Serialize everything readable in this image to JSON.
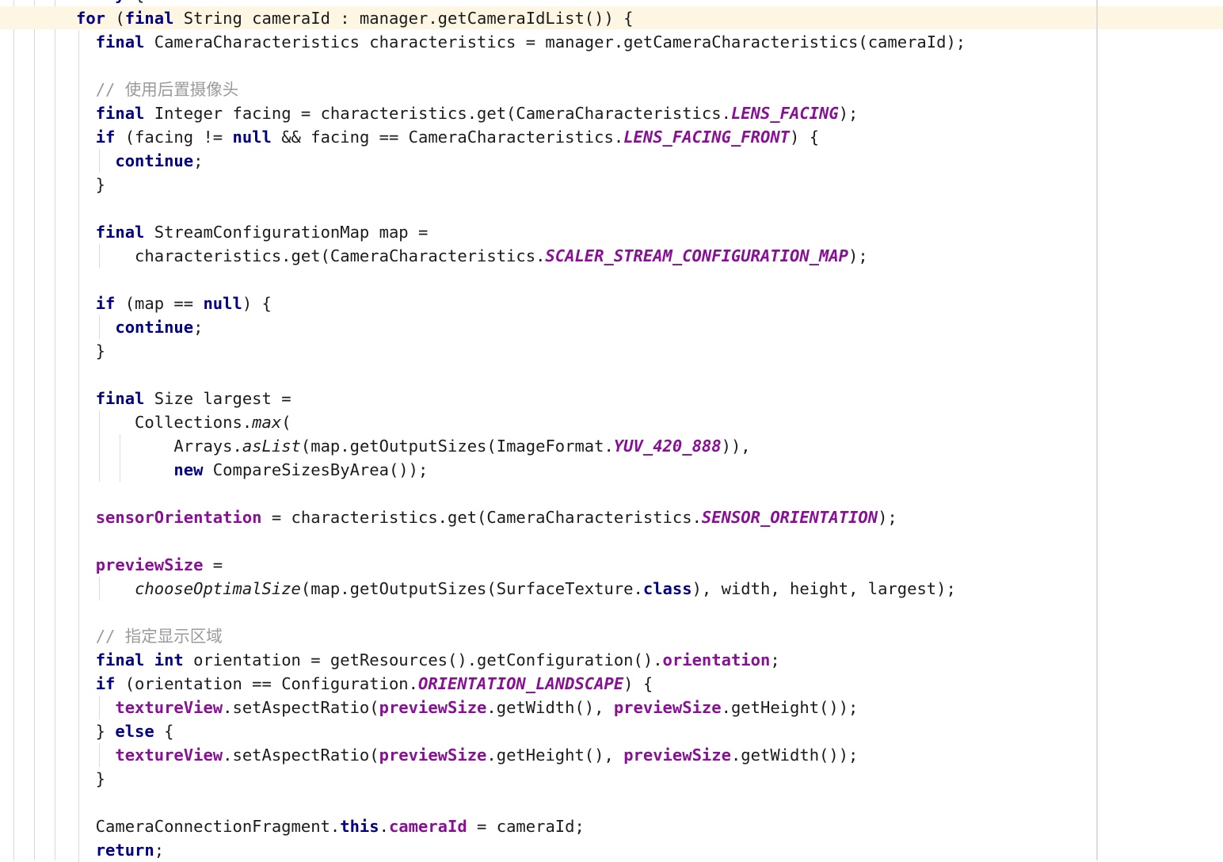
{
  "editor": {
    "kind": "java-source-code-editor",
    "language": "Java",
    "theme": "light",
    "font_size_px": 20,
    "line_height_px": 30,
    "right_margin_column_x": 1384,
    "colors": {
      "background": "#ffffff",
      "foreground": "#1b1b1b",
      "keyword": "#000080",
      "static_constant": "#871094",
      "field": "#871094",
      "comment": "#9a9a9a",
      "caret_line_highlight": "#fdf6e3",
      "indent_guide": "#d7d7d7",
      "right_margin_ruler": "#dcdcdc"
    }
  },
  "code_lines": [
    {
      "id": "l01",
      "clipped": true,
      "highlight": false,
      "guides": [],
      "tokens": [
        {
          "t": "plain",
          "v": "  "
        },
        {
          "t": "keyword",
          "v": "try"
        },
        {
          "t": "plain",
          "v": " {"
        }
      ]
    },
    {
      "id": "l02",
      "highlight": true,
      "guides": [],
      "tokens": [
        {
          "t": "keyword",
          "v": "for"
        },
        {
          "t": "plain",
          "v": " ("
        },
        {
          "t": "keyword",
          "v": "final"
        },
        {
          "t": "plain",
          "v": " String cameraId : manager.getCameraIdList()) {"
        }
      ]
    },
    {
      "id": "l03",
      "highlight": false,
      "guides": [
        "i95"
      ],
      "tokens": [
        {
          "t": "plain",
          "v": "  "
        },
        {
          "t": "keyword",
          "v": "final"
        },
        {
          "t": "plain",
          "v": " CameraCharacteristics characteristics = manager.getCameraCharacteristics(cameraId);"
        }
      ]
    },
    {
      "id": "l04",
      "highlight": false,
      "guides": [
        "i95"
      ],
      "tokens": []
    },
    {
      "id": "l05",
      "highlight": false,
      "guides": [
        "i95"
      ],
      "tokens": [
        {
          "t": "plain",
          "v": "  "
        },
        {
          "t": "comment",
          "v": "// 使用后置摄像头"
        }
      ]
    },
    {
      "id": "l06",
      "highlight": false,
      "guides": [
        "i95"
      ],
      "tokens": [
        {
          "t": "plain",
          "v": "  "
        },
        {
          "t": "keyword",
          "v": "final"
        },
        {
          "t": "plain",
          "v": " Integer facing = characteristics.get(CameraCharacteristics."
        },
        {
          "t": "static_constant",
          "v": "LENS_FACING"
        },
        {
          "t": "plain",
          "v": ");"
        }
      ]
    },
    {
      "id": "l07",
      "highlight": false,
      "guides": [
        "i95"
      ],
      "tokens": [
        {
          "t": "plain",
          "v": "  "
        },
        {
          "t": "keyword",
          "v": "if"
        },
        {
          "t": "plain",
          "v": " (facing != "
        },
        {
          "t": "keyword",
          "v": "null"
        },
        {
          "t": "plain",
          "v": " && facing == CameraCharacteristics."
        },
        {
          "t": "static_constant",
          "v": "LENS_FACING_FRONT"
        },
        {
          "t": "plain",
          "v": ") {"
        }
      ]
    },
    {
      "id": "l08",
      "highlight": false,
      "guides": [
        "i95",
        "i121"
      ],
      "tokens": [
        {
          "t": "plain",
          "v": "    "
        },
        {
          "t": "keyword",
          "v": "continue"
        },
        {
          "t": "plain",
          "v": ";"
        }
      ]
    },
    {
      "id": "l09",
      "highlight": false,
      "guides": [
        "i95"
      ],
      "tokens": [
        {
          "t": "plain",
          "v": "  }"
        }
      ]
    },
    {
      "id": "l10",
      "highlight": false,
      "guides": [
        "i95"
      ],
      "tokens": []
    },
    {
      "id": "l11",
      "highlight": false,
      "guides": [
        "i95"
      ],
      "tokens": [
        {
          "t": "plain",
          "v": "  "
        },
        {
          "t": "keyword",
          "v": "final"
        },
        {
          "t": "plain",
          "v": " StreamConfigurationMap map ="
        }
      ]
    },
    {
      "id": "l12",
      "highlight": false,
      "guides": [
        "i95",
        "i121"
      ],
      "tokens": [
        {
          "t": "plain",
          "v": "      characteristics.get(CameraCharacteristics."
        },
        {
          "t": "static_constant",
          "v": "SCALER_STREAM_CONFIGURATION_MAP"
        },
        {
          "t": "plain",
          "v": ");"
        }
      ]
    },
    {
      "id": "l13",
      "highlight": false,
      "guides": [
        "i95"
      ],
      "tokens": []
    },
    {
      "id": "l14",
      "highlight": false,
      "guides": [
        "i95"
      ],
      "tokens": [
        {
          "t": "plain",
          "v": "  "
        },
        {
          "t": "keyword",
          "v": "if"
        },
        {
          "t": "plain",
          "v": " (map == "
        },
        {
          "t": "keyword",
          "v": "null"
        },
        {
          "t": "plain",
          "v": ") {"
        }
      ]
    },
    {
      "id": "l15",
      "highlight": false,
      "guides": [
        "i95",
        "i121"
      ],
      "tokens": [
        {
          "t": "plain",
          "v": "    "
        },
        {
          "t": "keyword",
          "v": "continue"
        },
        {
          "t": "plain",
          "v": ";"
        }
      ]
    },
    {
      "id": "l16",
      "highlight": false,
      "guides": [
        "i95"
      ],
      "tokens": [
        {
          "t": "plain",
          "v": "  }"
        }
      ]
    },
    {
      "id": "l17",
      "highlight": false,
      "guides": [
        "i95"
      ],
      "tokens": []
    },
    {
      "id": "l18",
      "highlight": false,
      "guides": [
        "i95"
      ],
      "tokens": [
        {
          "t": "plain",
          "v": "  "
        },
        {
          "t": "keyword",
          "v": "final"
        },
        {
          "t": "plain",
          "v": " Size largest ="
        }
      ]
    },
    {
      "id": "l19",
      "highlight": false,
      "guides": [
        "i95",
        "i121"
      ],
      "tokens": [
        {
          "t": "plain",
          "v": "      Collections."
        },
        {
          "t": "static_method",
          "v": "max"
        },
        {
          "t": "plain",
          "v": "("
        }
      ]
    },
    {
      "id": "l20",
      "highlight": false,
      "guides": [
        "i95",
        "i121",
        "i147"
      ],
      "tokens": [
        {
          "t": "plain",
          "v": "          Arrays."
        },
        {
          "t": "static_method",
          "v": "asList"
        },
        {
          "t": "plain",
          "v": "(map.getOutputSizes(ImageFormat."
        },
        {
          "t": "static_constant",
          "v": "YUV_420_888"
        },
        {
          "t": "plain",
          "v": ")),"
        }
      ]
    },
    {
      "id": "l21",
      "highlight": false,
      "guides": [
        "i95",
        "i121",
        "i147"
      ],
      "tokens": [
        {
          "t": "plain",
          "v": "          "
        },
        {
          "t": "keyword",
          "v": "new"
        },
        {
          "t": "plain",
          "v": " CompareSizesByArea());"
        }
      ]
    },
    {
      "id": "l22",
      "highlight": false,
      "guides": [
        "i95"
      ],
      "tokens": []
    },
    {
      "id": "l23",
      "highlight": false,
      "guides": [
        "i95"
      ],
      "tokens": [
        {
          "t": "plain",
          "v": "  "
        },
        {
          "t": "field",
          "v": "sensorOrientation"
        },
        {
          "t": "plain",
          "v": " = characteristics.get(CameraCharacteristics."
        },
        {
          "t": "static_constant",
          "v": "SENSOR_ORIENTATION"
        },
        {
          "t": "plain",
          "v": ");"
        }
      ]
    },
    {
      "id": "l24",
      "highlight": false,
      "guides": [
        "i95"
      ],
      "tokens": []
    },
    {
      "id": "l25",
      "highlight": false,
      "guides": [
        "i95"
      ],
      "tokens": [
        {
          "t": "plain",
          "v": "  "
        },
        {
          "t": "field",
          "v": "previewSize"
        },
        {
          "t": "plain",
          "v": " ="
        }
      ]
    },
    {
      "id": "l26",
      "highlight": false,
      "guides": [
        "i95",
        "i121"
      ],
      "tokens": [
        {
          "t": "plain",
          "v": "      "
        },
        {
          "t": "static_method",
          "v": "chooseOptimalSize"
        },
        {
          "t": "plain",
          "v": "(map.getOutputSizes(SurfaceTexture."
        },
        {
          "t": "keyword",
          "v": "class"
        },
        {
          "t": "plain",
          "v": "), width, height, largest);"
        }
      ]
    },
    {
      "id": "l27",
      "highlight": false,
      "guides": [
        "i95"
      ],
      "tokens": []
    },
    {
      "id": "l28",
      "highlight": false,
      "guides": [
        "i95"
      ],
      "tokens": [
        {
          "t": "plain",
          "v": "  "
        },
        {
          "t": "comment",
          "v": "// 指定显示区域"
        }
      ]
    },
    {
      "id": "l29",
      "highlight": false,
      "guides": [
        "i95"
      ],
      "tokens": [
        {
          "t": "plain",
          "v": "  "
        },
        {
          "t": "keyword",
          "v": "final"
        },
        {
          "t": "plain",
          "v": " "
        },
        {
          "t": "keyword",
          "v": "int"
        },
        {
          "t": "plain",
          "v": " orientation = getResources().getConfiguration()."
        },
        {
          "t": "field",
          "v": "orientation"
        },
        {
          "t": "plain",
          "v": ";"
        }
      ]
    },
    {
      "id": "l30",
      "highlight": false,
      "guides": [
        "i95"
      ],
      "tokens": [
        {
          "t": "plain",
          "v": "  "
        },
        {
          "t": "keyword",
          "v": "if"
        },
        {
          "t": "plain",
          "v": " (orientation == Configuration."
        },
        {
          "t": "static_constant",
          "v": "ORIENTATION_LANDSCAPE"
        },
        {
          "t": "plain",
          "v": ") {"
        }
      ]
    },
    {
      "id": "l31",
      "highlight": false,
      "guides": [
        "i95",
        "i121"
      ],
      "tokens": [
        {
          "t": "plain",
          "v": "    "
        },
        {
          "t": "field",
          "v": "textureView"
        },
        {
          "t": "plain",
          "v": ".setAspectRatio("
        },
        {
          "t": "field",
          "v": "previewSize"
        },
        {
          "t": "plain",
          "v": ".getWidth(), "
        },
        {
          "t": "field",
          "v": "previewSize"
        },
        {
          "t": "plain",
          "v": ".getHeight());"
        }
      ]
    },
    {
      "id": "l32",
      "highlight": false,
      "guides": [
        "i95"
      ],
      "tokens": [
        {
          "t": "plain",
          "v": "  } "
        },
        {
          "t": "keyword",
          "v": "else"
        },
        {
          "t": "plain",
          "v": " {"
        }
      ]
    },
    {
      "id": "l33",
      "highlight": false,
      "guides": [
        "i95",
        "i121"
      ],
      "tokens": [
        {
          "t": "plain",
          "v": "    "
        },
        {
          "t": "field",
          "v": "textureView"
        },
        {
          "t": "plain",
          "v": ".setAspectRatio("
        },
        {
          "t": "field",
          "v": "previewSize"
        },
        {
          "t": "plain",
          "v": ".getHeight(), "
        },
        {
          "t": "field",
          "v": "previewSize"
        },
        {
          "t": "plain",
          "v": ".getWidth());"
        }
      ]
    },
    {
      "id": "l34",
      "highlight": false,
      "guides": [
        "i95"
      ],
      "tokens": [
        {
          "t": "plain",
          "v": "  }"
        }
      ]
    },
    {
      "id": "l35",
      "highlight": false,
      "guides": [
        "i95"
      ],
      "tokens": []
    },
    {
      "id": "l36",
      "highlight": false,
      "guides": [
        "i95"
      ],
      "tokens": [
        {
          "t": "plain",
          "v": "  CameraConnectionFragment."
        },
        {
          "t": "keyword",
          "v": "this"
        },
        {
          "t": "plain",
          "v": "."
        },
        {
          "t": "field",
          "v": "cameraId"
        },
        {
          "t": "plain",
          "v": " = cameraId;"
        }
      ]
    },
    {
      "id": "l37",
      "highlight": false,
      "guides": [
        "i95"
      ],
      "tokens": [
        {
          "t": "plain",
          "v": "  "
        },
        {
          "t": "keyword",
          "v": "return"
        },
        {
          "t": "plain",
          "v": ";"
        }
      ]
    }
  ]
}
